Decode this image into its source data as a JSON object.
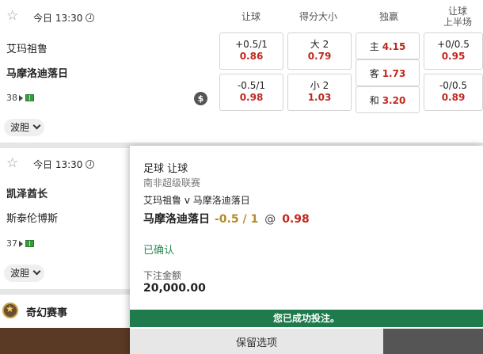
{
  "columns": {
    "handicap": "让球",
    "totals": "得分大小",
    "moneyline": "独赢",
    "first_half_line1": "让球",
    "first_half_line2": "上半场"
  },
  "match1": {
    "time": "今日 13:30",
    "home": "艾玛祖鲁",
    "away": "马摩洛迪落日",
    "markets_count": "38",
    "cashout_symbol": "$",
    "bodan": "波胆",
    "handicap": [
      {
        "line": "+0.5/1",
        "odds": "0.86"
      },
      {
        "line": "-0.5/1",
        "odds": "0.98"
      }
    ],
    "totals": [
      {
        "line": "大 2",
        "odds": "0.79"
      },
      {
        "line": "小 2",
        "odds": "1.03"
      }
    ],
    "moneyline": [
      {
        "label": "主",
        "odds": "4.15"
      },
      {
        "label": "客",
        "odds": "1.73"
      },
      {
        "label": "和",
        "odds": "3.20"
      }
    ],
    "first_half": [
      {
        "line": "+0/0.5",
        "odds": "0.95"
      },
      {
        "line": "-0/0.5",
        "odds": "0.89"
      }
    ]
  },
  "match2": {
    "time": "今日 13:30",
    "home": "凯泽酋长",
    "away": "斯泰伦博斯",
    "markets_count": "37",
    "bodan": "波胆"
  },
  "fantasy": {
    "label": "奇幻赛事"
  },
  "bet_slip": {
    "bet_type": "足球 让球",
    "league": "南非超级联赛",
    "match": "艾玛祖鲁 v 马摩洛迪落日",
    "selection": "马摩洛迪落日",
    "line": "-0.5 / 1",
    "at": "@",
    "odds": "0.98",
    "status": "已确认",
    "stake_label": "下注金额",
    "stake": "20,000.00",
    "success_message": "您已成功投注。",
    "keep_selections": "保留选项"
  },
  "colors": {
    "odds_red": "#c0281f",
    "confirmed_green": "#2e8b57",
    "success_bar": "#1f7a4c",
    "line_gold": "#b58a2a"
  }
}
